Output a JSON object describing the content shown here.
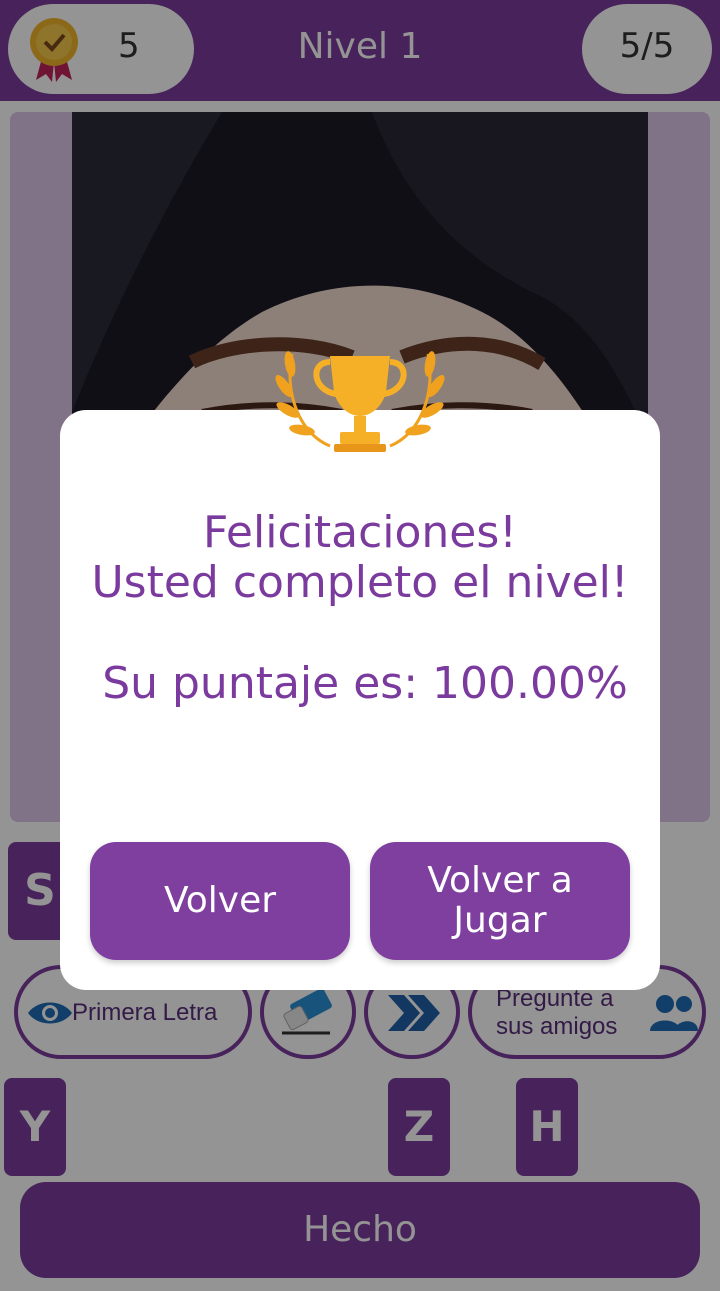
{
  "header": {
    "coins": "5",
    "level_title": "Nivel 1",
    "progress": "5/5"
  },
  "answer": {
    "revealed_letter": "S"
  },
  "hints": {
    "first_letter_label": "Primera Letra",
    "ask_friends_label": "Pregunte a sus amigos",
    "ask_friends_line1": "Pregunte a",
    "ask_friends_line2": "sus amigos"
  },
  "letters": [
    "Y",
    "Z",
    "H"
  ],
  "done_button": "Hecho",
  "dialog": {
    "title_line1": "Felicitaciones!",
    "title_line2": "Usted completo el nivel!",
    "score": "Su puntaje es: 100.00%",
    "back_button": "Volver",
    "replay_line1": "Volver a",
    "replay_line2": "Jugar"
  },
  "colors": {
    "brand_purple": "#7b3b9e",
    "trophy_gold": "#f5b027"
  },
  "icons": [
    "medal-icon",
    "eye-icon",
    "eraser-icon",
    "skip-icon",
    "friends-icon",
    "trophy-icon"
  ]
}
